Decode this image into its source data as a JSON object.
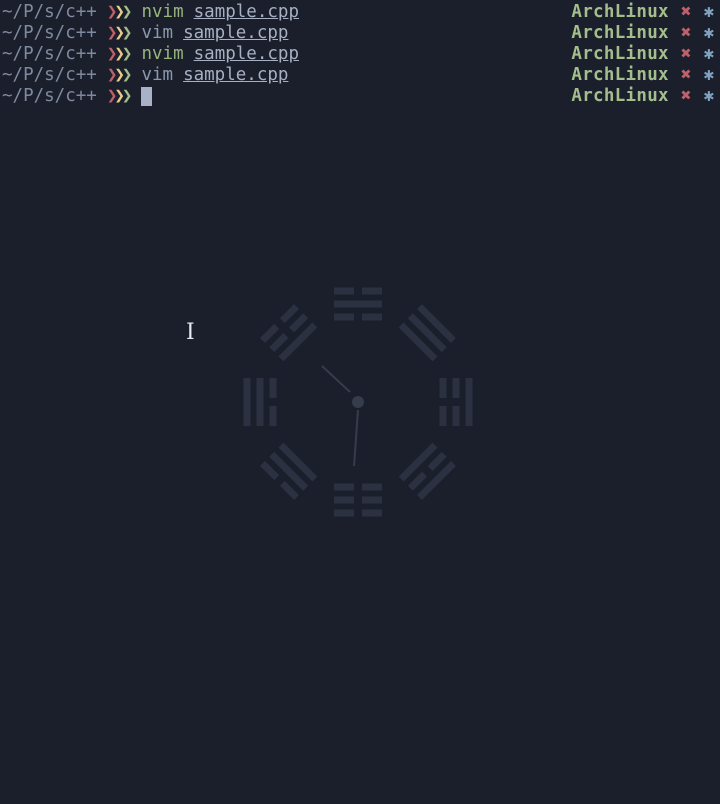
{
  "terminal": {
    "lines": [
      {
        "path": "~/P/s/c++",
        "command": "nvim",
        "argument": "sample.cpp",
        "host": "ArchLinux"
      },
      {
        "path": "~/P/s/c++",
        "command": "vim",
        "argument": "sample.cpp",
        "host": "ArchLinux"
      },
      {
        "path": "~/P/s/c++",
        "command": "nvim",
        "argument": "sample.cpp",
        "host": "ArchLinux"
      },
      {
        "path": "~/P/s/c++",
        "command": "vim",
        "argument": "sample.cpp",
        "host": "ArchLinux"
      }
    ],
    "prompt": {
      "path": "~/P/s/c++",
      "host": "ArchLinux"
    },
    "prompt_symbol": "❯❯❯",
    "status_symbol": "✖",
    "job_symbol": "✱"
  },
  "colors": {
    "background": "#1a1f2b",
    "chevron_1": "#bf616a",
    "chevron_2": "#ebcb8b",
    "chevron_3": "#a3be8c",
    "host": "#a3be8c",
    "status_error": "#bf616a",
    "job_marker": "#81a1c1"
  },
  "pointer": {
    "icon": "text-cursor-ibeam-icon"
  }
}
